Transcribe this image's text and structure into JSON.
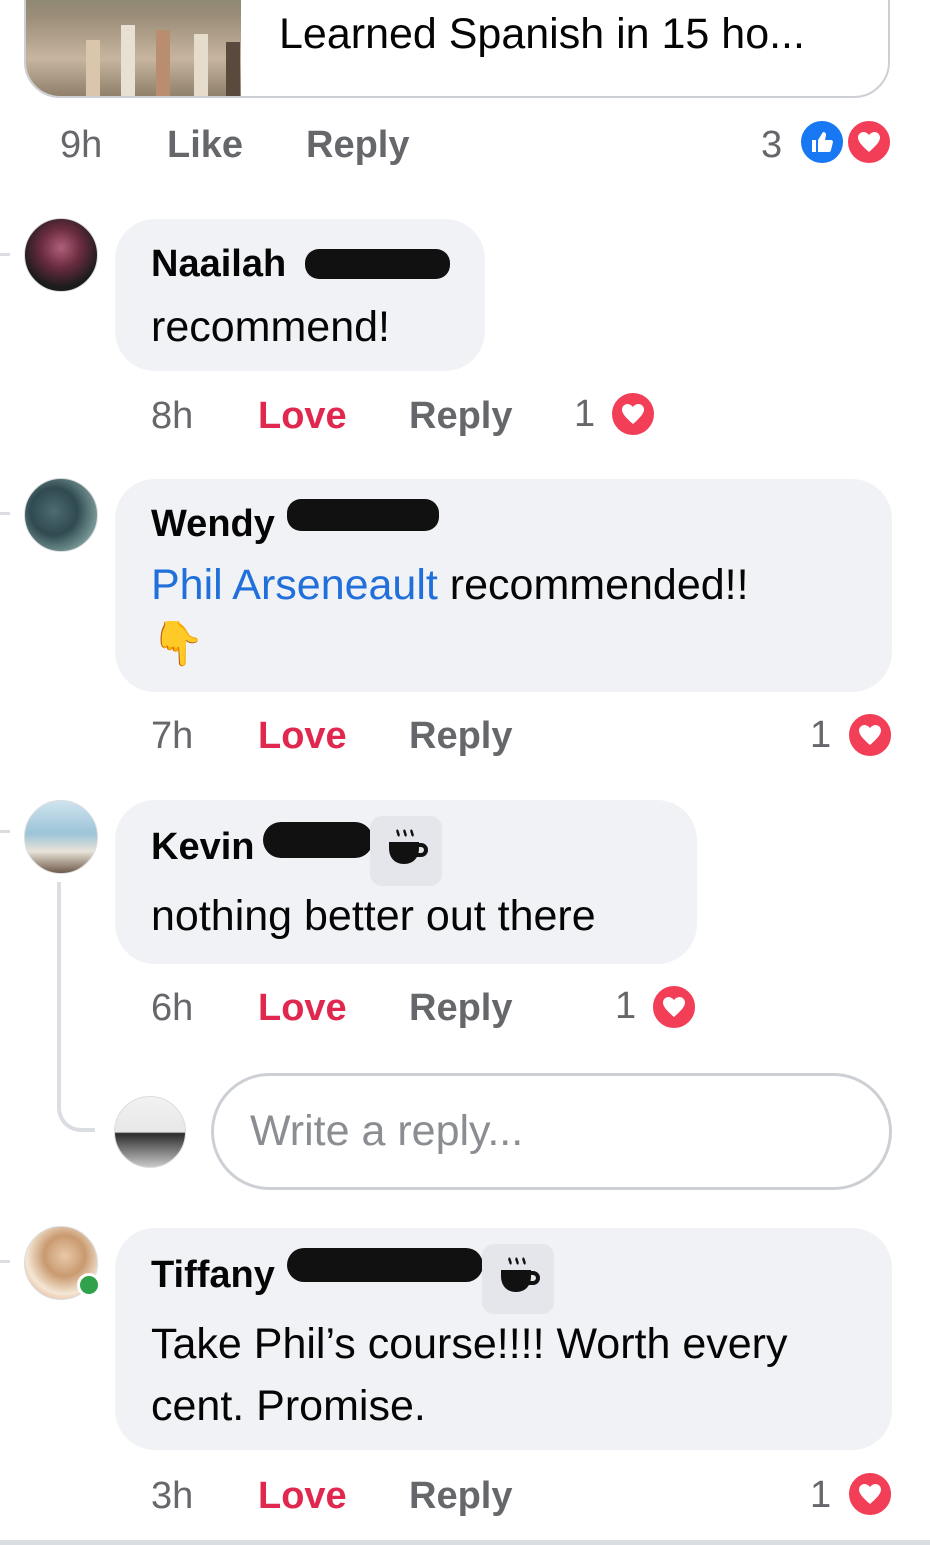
{
  "top_post": {
    "preview_title": "Learned Spanish in 15 ho...",
    "time": "9h",
    "like_label": "Like",
    "reply_label": "Reply",
    "reaction_count": "3"
  },
  "comments": [
    {
      "author": "Naailah",
      "text": "recommend!",
      "time": "8h",
      "reaction_label": "Love",
      "reply_label": "Reply",
      "reaction_count": "1"
    },
    {
      "author": "Wendy",
      "mention": "Phil Arseneault",
      "text": " recommended!!",
      "emoji": "👇",
      "time": "7h",
      "reaction_label": "Love",
      "reply_label": "Reply",
      "reaction_count": "1"
    },
    {
      "author": "Kevin",
      "text": "nothing better out there",
      "time": "6h",
      "reaction_label": "Love",
      "reply_label": "Reply",
      "reaction_count": "1"
    },
    {
      "author": "Tiffany",
      "text_line1": "Take Phil’s course!!!!  Worth every",
      "text_line2": "cent.  Promise.",
      "time": "3h",
      "reaction_label": "Love",
      "reply_label": "Reply",
      "reaction_count": "1"
    }
  ],
  "reply_box": {
    "placeholder": "Write a reply..."
  },
  "colors": {
    "love": "#e0284f",
    "mention": "#216fdb",
    "bubble": "#f0f2f5",
    "meta": "#65676b"
  },
  "icons": {
    "like": "thumbs-up-icon",
    "love": "heart-icon",
    "badge": "coffee-cup-icon"
  }
}
